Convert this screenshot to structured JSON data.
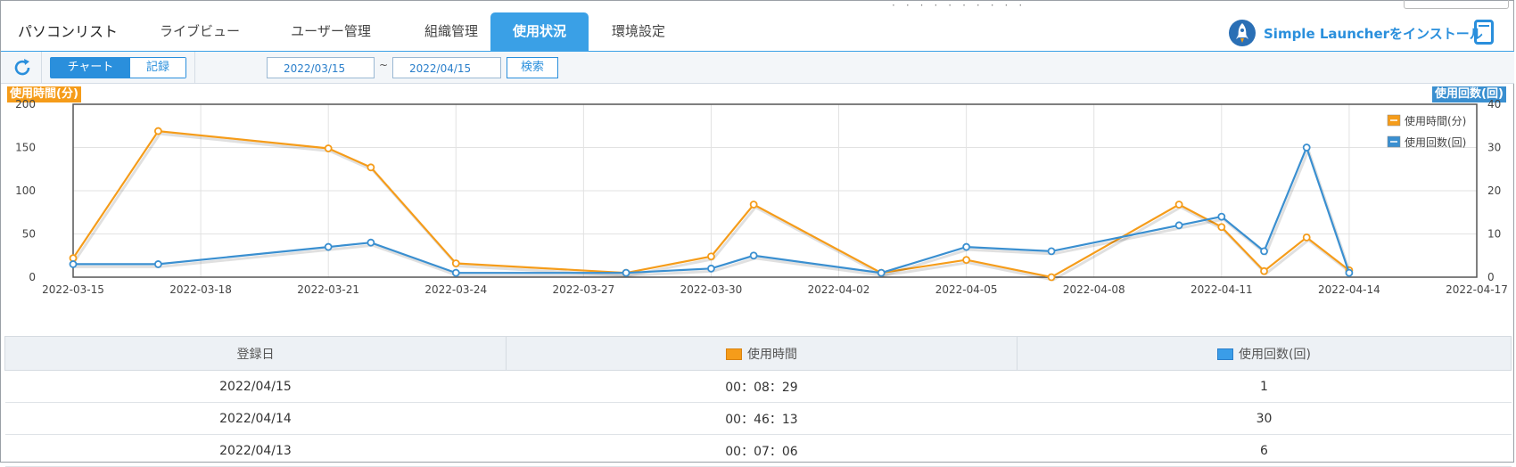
{
  "nav": {
    "tabs": [
      {
        "label": "パソコンリスト",
        "active": false
      },
      {
        "label": "ライブビュー",
        "active": false
      },
      {
        "label": "ユーザー管理",
        "active": false
      },
      {
        "label": "組織管理",
        "active": false
      },
      {
        "label": "使用状況",
        "active": true
      },
      {
        "label": "環境設定",
        "active": false
      }
    ],
    "launcher_label": "Simple Launcherをインストール"
  },
  "toolbar": {
    "view_chart": "チャート",
    "view_record": "記録",
    "date_from": "2022/03/15",
    "range_separator": "~",
    "date_to": "2022/04/15",
    "search_label": "検索"
  },
  "colors": {
    "accent": "#3aa0e6",
    "time_series": "#f59c1a",
    "count_series": "#3a8fd0"
  },
  "chart_data": {
    "type": "line",
    "y_left_label": "使用時間(分)",
    "y_right_label": "使用回数(回)",
    "ylim_left": [
      0,
      200
    ],
    "ylim_right": [
      0,
      40
    ],
    "y_left_ticks": [
      "0",
      "50",
      "100",
      "150",
      "200"
    ],
    "y_right_ticks": [
      "0",
      "10",
      "20",
      "30",
      "40"
    ],
    "x_ticks": [
      "2022-03-15",
      "2022-03-18",
      "2022-03-21",
      "2022-03-24",
      "2022-03-27",
      "2022-03-30",
      "2022-04-02",
      "2022-04-05",
      "2022-04-08",
      "2022-04-11",
      "2022-04-14",
      "2022-04-17"
    ],
    "grid": true,
    "legend_position": "top-right",
    "series": [
      {
        "name": "使用時間(分)",
        "axis": "left",
        "x": [
          "2022-03-15",
          "2022-03-17",
          "2022-03-21",
          "2022-03-22",
          "2022-03-24",
          "2022-03-28",
          "2022-03-30",
          "2022-03-31",
          "2022-04-03",
          "2022-04-05",
          "2022-04-07",
          "2022-04-10",
          "2022-04-11",
          "2022-04-12",
          "2022-04-13",
          "2022-04-14"
        ],
        "values": [
          22,
          169,
          149,
          127,
          16,
          5,
          24,
          84,
          5,
          20,
          0,
          84,
          58,
          7,
          46,
          8
        ]
      },
      {
        "name": "使用回数(回)",
        "axis": "right",
        "x": [
          "2022-03-15",
          "2022-03-17",
          "2022-03-21",
          "2022-03-22",
          "2022-03-24",
          "2022-03-28",
          "2022-03-30",
          "2022-03-31",
          "2022-04-03",
          "2022-04-05",
          "2022-04-07",
          "2022-04-10",
          "2022-04-11",
          "2022-04-12",
          "2022-04-13",
          "2022-04-14"
        ],
        "values": [
          3,
          3,
          7,
          8,
          1,
          1,
          2,
          5,
          1,
          7,
          6,
          12,
          14,
          6,
          30,
          1
        ]
      }
    ]
  },
  "table": {
    "headers": [
      "登録日",
      "使用時間",
      "使用回数(回)"
    ],
    "rows": [
      [
        "2022/04/15",
        "00：08：29",
        "1"
      ],
      [
        "2022/04/14",
        "00：46：13",
        "30"
      ],
      [
        "2022/04/13",
        "00：07：06",
        "6"
      ]
    ]
  }
}
